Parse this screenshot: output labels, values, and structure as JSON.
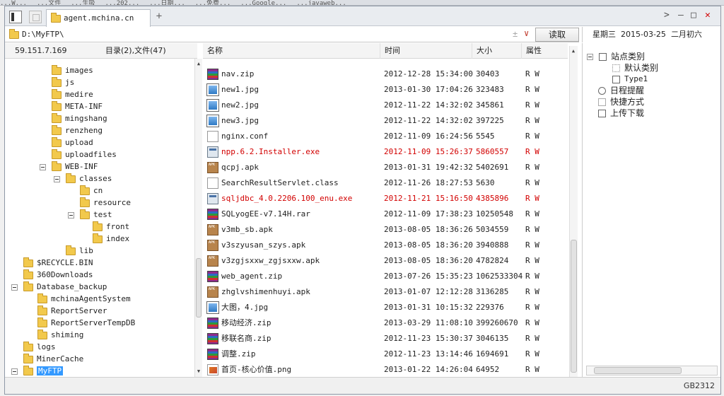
{
  "browser_strip": [
    "...W...",
    "...文件",
    "...生吸",
    "...202...",
    "...日期...",
    "...免费...",
    "...Google...",
    "...javaweb..."
  ],
  "tab": {
    "title": "agent.mchina.cn"
  },
  "address": {
    "path": "D:\\MyFTP\\",
    "read_button": "读取"
  },
  "calendar": {
    "weekday": "星期三",
    "date": "2015-03-25",
    "lunar": "二月初六"
  },
  "left_header": {
    "ip": "59.151.7.169",
    "summary": "目录(2),文件(47)"
  },
  "tree": [
    {
      "label": "images",
      "level": 4,
      "exp": false
    },
    {
      "label": "js",
      "level": 4,
      "exp": false
    },
    {
      "label": "medire",
      "level": 4,
      "exp": false
    },
    {
      "label": "META-INF",
      "level": 4,
      "exp": false
    },
    {
      "label": "mingshang",
      "level": 4,
      "exp": false
    },
    {
      "label": "renzheng",
      "level": 4,
      "exp": false
    },
    {
      "label": "upload",
      "level": 4,
      "exp": false
    },
    {
      "label": "uploadfiles",
      "level": 4,
      "exp": false
    },
    {
      "label": "WEB-INF",
      "level": 4,
      "exp": true
    },
    {
      "label": "classes",
      "level": 5,
      "exp": true
    },
    {
      "label": "cn",
      "level": 6,
      "exp": false
    },
    {
      "label": "resource",
      "level": 6,
      "exp": false
    },
    {
      "label": "test",
      "level": 6,
      "exp": true
    },
    {
      "label": "front",
      "level": 7,
      "exp": false
    },
    {
      "label": "index",
      "level": 7,
      "exp": false
    },
    {
      "label": "lib",
      "level": 5,
      "exp": false
    },
    {
      "label": "$RECYCLE.BIN",
      "level": 1,
      "exp": false
    },
    {
      "label": "360Downloads",
      "level": 1,
      "exp": false
    },
    {
      "label": "Database_backup",
      "level": 1,
      "exp": true
    },
    {
      "label": "mchinaAgentSystem",
      "level": 2,
      "exp": false
    },
    {
      "label": "ReportServer",
      "level": 2,
      "exp": false
    },
    {
      "label": "ReportServerTempDB",
      "level": 2,
      "exp": false
    },
    {
      "label": "shiming",
      "level": 2,
      "exp": false
    },
    {
      "label": "logs",
      "level": 1,
      "exp": false
    },
    {
      "label": "MinerCache",
      "level": 1,
      "exp": false
    },
    {
      "label": "MyFTP",
      "level": 1,
      "exp": true,
      "selected": true
    }
  ],
  "columns": {
    "name": "名称",
    "time": "时间",
    "size": "大小",
    "attr": "属性"
  },
  "files": [
    {
      "name": "nav.zip",
      "date": "2012-12-28 15:34:00",
      "size": "30403",
      "attr": "R W",
      "icon": "zip",
      "red": false
    },
    {
      "name": "new1.jpg",
      "date": "2013-01-30 17:04:26",
      "size": "323483",
      "attr": "R W",
      "icon": "img",
      "red": false
    },
    {
      "name": "new2.jpg",
      "date": "2012-11-22 14:32:02",
      "size": "345861",
      "attr": "R W",
      "icon": "img",
      "red": false
    },
    {
      "name": "new3.jpg",
      "date": "2012-11-22 14:32:02",
      "size": "397225",
      "attr": "R W",
      "icon": "img",
      "red": false
    },
    {
      "name": "nginx.conf",
      "date": "2012-11-09 16:24:56",
      "size": "5545",
      "attr": "R W",
      "icon": "file",
      "red": false
    },
    {
      "name": "npp.6.2.Installer.exe",
      "date": "2012-11-09 15:26:37",
      "size": "5860557",
      "attr": "R W",
      "icon": "exe",
      "red": true
    },
    {
      "name": "qcpj.apk",
      "date": "2013-01-31 19:42:32",
      "size": "5402691",
      "attr": "R W",
      "icon": "apk",
      "red": false
    },
    {
      "name": "SearchResultServlet.class",
      "date": "2012-11-26 18:27:53",
      "size": "5630",
      "attr": "R W",
      "icon": "file",
      "red": false
    },
    {
      "name": "sqljdbc_4.0.2206.100_enu.exe",
      "date": "2012-11-21 15:16:50",
      "size": "4385896",
      "attr": "R W",
      "icon": "exe",
      "red": true
    },
    {
      "name": "SQLyogEE-v7.14H.rar",
      "date": "2012-11-09 17:38:23",
      "size": "10250548",
      "attr": "R W",
      "icon": "zip",
      "red": false
    },
    {
      "name": "v3mb_sb.apk",
      "date": "2013-08-05 18:36:26",
      "size": "5034559",
      "attr": "R W",
      "icon": "apk",
      "red": false
    },
    {
      "name": "v3szyusan_szys.apk",
      "date": "2013-08-05 18:36:20",
      "size": "3940888",
      "attr": "R W",
      "icon": "apk",
      "red": false
    },
    {
      "name": "v3zgjsxxw_zgjsxxw.apk",
      "date": "2013-08-05 18:36:20",
      "size": "4782824",
      "attr": "R W",
      "icon": "apk",
      "red": false
    },
    {
      "name": "web_agent.zip",
      "date": "2013-07-26 15:35:23",
      "size": "1062533304",
      "attr": "R W",
      "icon": "zip",
      "red": false
    },
    {
      "name": "zhglvshimenhuyi.apk",
      "date": "2013-01-07 12:12:28",
      "size": "3136285",
      "attr": "R W",
      "icon": "apk",
      "red": false
    },
    {
      "name": "大图，4.jpg",
      "date": "2013-01-31 10:15:32",
      "size": "229376",
      "attr": "R W",
      "icon": "img",
      "red": false
    },
    {
      "name": "移动经济.zip",
      "date": "2013-03-29 11:08:10",
      "size": "399260670",
      "attr": "R W",
      "icon": "zip",
      "red": false
    },
    {
      "name": "移联名商.zip",
      "date": "2012-11-23 15:30:37",
      "size": "3046135",
      "attr": "R W",
      "icon": "zip",
      "red": false
    },
    {
      "name": "调整.zip",
      "date": "2012-11-23 13:14:46",
      "size": "1694691",
      "attr": "R W",
      "icon": "zip",
      "red": false
    },
    {
      "name": "首页-核心价值.png",
      "date": "2013-01-22 14:26:04",
      "size": "64952",
      "attr": "R W",
      "icon": "png",
      "red": false
    }
  ],
  "sidebar": {
    "site_category": "站点类别",
    "default_category": "默认类别",
    "type1": "Type1",
    "schedule": "日程提醒",
    "shortcuts": "快捷方式",
    "transfers": "上传下载"
  },
  "status": {
    "encoding": "GB2312"
  }
}
